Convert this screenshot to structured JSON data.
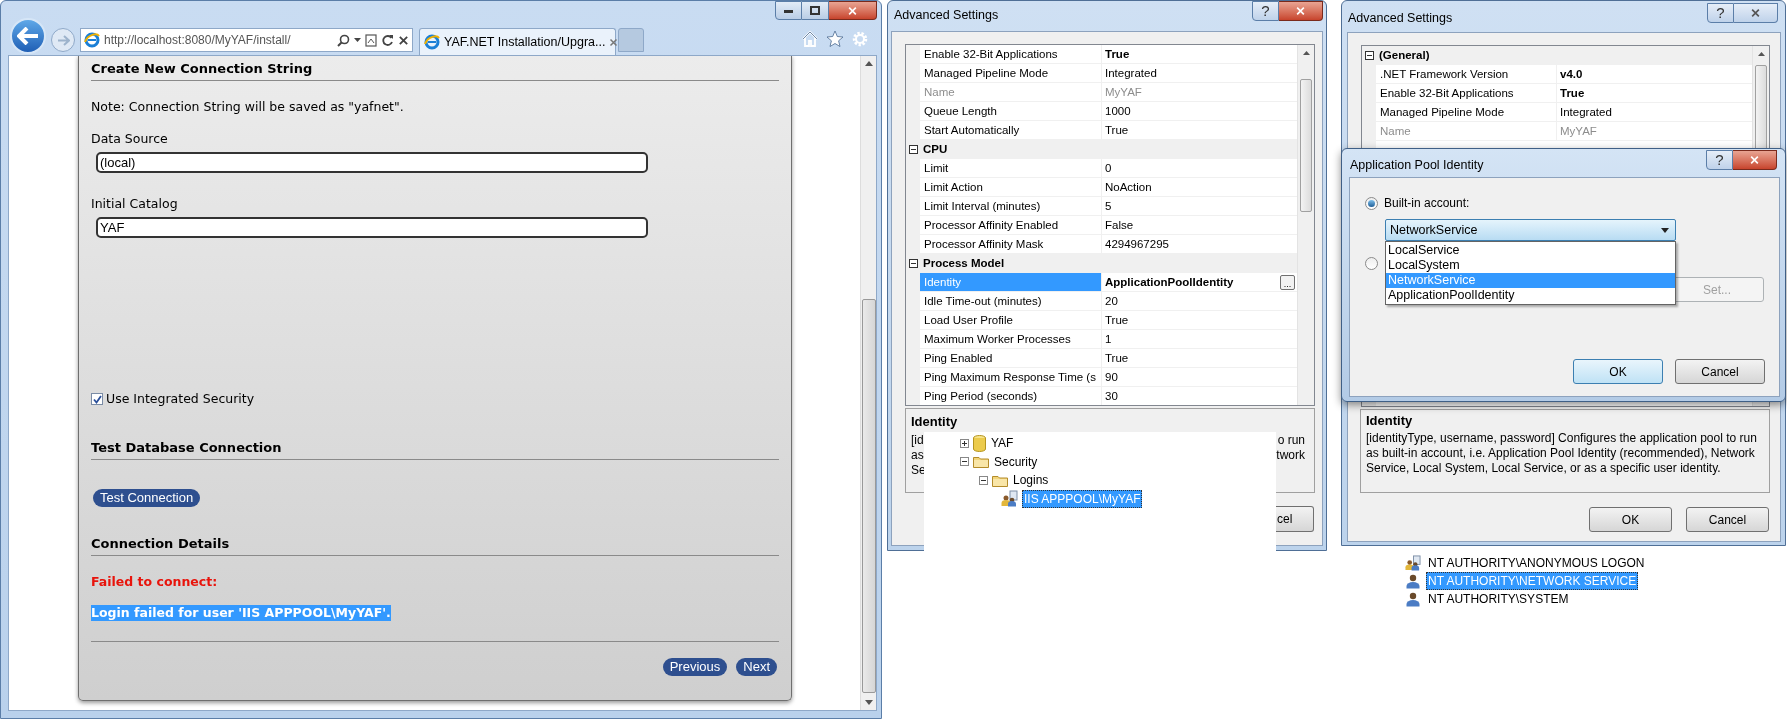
{
  "browser": {
    "address": "http://localhost:8080/MyYAF/install/",
    "tab_title": "YAF.NET Installation/Upgra..."
  },
  "page": {
    "heading_1": "Create New Connection String",
    "note": "Note: Connection String will be saved as \"yafnet\".",
    "fields": [
      {
        "label": "Data Source",
        "value": "(local)"
      },
      {
        "label": "Initial Catalog",
        "value": "YAF"
      }
    ],
    "integrated_security": {
      "label": "Use Integrated Security",
      "checked": true
    },
    "heading_2": "Test Database Connection",
    "test_button": "Test Connection",
    "heading_3": "Connection Details",
    "error_title": "Failed to connect:",
    "error_message": {
      "text": "Login failed for user 'IIS APPPOOL\\MyYAF'.",
      "selected": true
    },
    "nav_buttons": [
      "Previous",
      "Next"
    ]
  },
  "settings_window_left": {
    "title": "Advanced Settings",
    "help_button": "?",
    "rows": [
      {
        "kind": "property",
        "name": "Enable 32-Bit Applications",
        "value": "True",
        "modified": true,
        "disabled": false,
        "selected": false
      },
      {
        "kind": "property",
        "name": "Managed Pipeline Mode",
        "value": "Integrated",
        "modified": false,
        "disabled": false,
        "selected": false
      },
      {
        "kind": "property",
        "name": "Name",
        "value": "MyYAF",
        "modified": false,
        "disabled": true,
        "selected": false
      },
      {
        "kind": "property",
        "name": "Queue Length",
        "value": "1000",
        "modified": false,
        "disabled": false,
        "selected": false
      },
      {
        "kind": "property",
        "name": "Start Automatically",
        "value": "True",
        "modified": false,
        "disabled": false,
        "selected": false
      },
      {
        "kind": "category",
        "name": "CPU",
        "expanded": true,
        "selected": false
      },
      {
        "kind": "property",
        "name": "Limit",
        "value": "0",
        "modified": false,
        "disabled": false,
        "selected": false
      },
      {
        "kind": "property",
        "name": "Limit Action",
        "value": "NoAction",
        "modified": false,
        "disabled": false,
        "selected": false
      },
      {
        "kind": "property",
        "name": "Limit Interval (minutes)",
        "value": "5",
        "modified": false,
        "disabled": false,
        "selected": false
      },
      {
        "kind": "property",
        "name": "Processor Affinity Enabled",
        "value": "False",
        "modified": false,
        "disabled": false,
        "selected": false
      },
      {
        "kind": "property",
        "name": "Processor Affinity Mask",
        "value": "4294967295",
        "modified": false,
        "disabled": false,
        "selected": false
      },
      {
        "kind": "category",
        "name": "Process Model",
        "expanded": true,
        "selected": false
      },
      {
        "kind": "property",
        "name": "Identity",
        "value": "ApplicationPoolIdentity",
        "modified": true,
        "disabled": false,
        "selected": true,
        "button": "..."
      },
      {
        "kind": "property",
        "name": "Idle Time-out (minutes)",
        "value": "20",
        "modified": false,
        "disabled": false,
        "selected": false
      },
      {
        "kind": "property",
        "name": "Load User Profile",
        "value": "True",
        "modified": false,
        "disabled": false,
        "selected": false
      },
      {
        "kind": "property",
        "name": "Maximum Worker Processes",
        "value": "1",
        "modified": false,
        "disabled": false,
        "selected": false
      },
      {
        "kind": "property",
        "name": "Ping Enabled",
        "value": "True",
        "modified": false,
        "disabled": false,
        "selected": false
      },
      {
        "kind": "property",
        "name": "Ping Maximum Response Time (s",
        "value": "90",
        "modified": false,
        "disabled": false,
        "selected": false
      },
      {
        "kind": "property",
        "name": "Ping Period (seconds)",
        "value": "30",
        "modified": false,
        "disabled": false,
        "selected": false
      }
    ],
    "description": {
      "title": "Identity",
      "left_fragments": [
        "[id",
        "as",
        "Se"
      ],
      "right_fragments": [
        "o run",
        "twork"
      ]
    },
    "cancel_fragment": "cel"
  },
  "login_tree": [
    {
      "label": "YAF",
      "kind": "database",
      "expanded": false,
      "selected": false
    },
    {
      "label": "Security",
      "kind": "folder",
      "expanded": true,
      "selected": false,
      "children": [
        {
          "label": "Logins",
          "kind": "folder",
          "expanded": true,
          "selected": false,
          "children": [
            {
              "label": "IIS APPPOOL\\MyYAF",
              "kind": "login",
              "selected": true
            }
          ]
        }
      ]
    }
  ],
  "settings_window_right": {
    "title": "Advanced Settings",
    "help_button": "?",
    "rows": [
      {
        "kind": "category",
        "name": "(General)",
        "expanded": true,
        "selected": false
      },
      {
        "kind": "property",
        "name": ".NET Framework Version",
        "value": "v4.0",
        "modified": true,
        "disabled": false,
        "selected": false
      },
      {
        "kind": "property",
        "name": "Enable 32-Bit Applications",
        "value": "True",
        "modified": true,
        "disabled": false,
        "selected": false
      },
      {
        "kind": "property",
        "name": "Managed Pipeline Mode",
        "value": "Integrated",
        "modified": false,
        "disabled": false,
        "selected": false
      },
      {
        "kind": "property",
        "name": "Name",
        "value": "MyYAF",
        "modified": false,
        "disabled": true,
        "selected": false
      }
    ],
    "description": {
      "title": "Identity",
      "text": "[identityType, username, password] Configures the application pool to run as built-in account, i.e. Application Pool Identity (recommended), Network Service, Local System, Local Service, or as a specific user identity."
    },
    "buttons": [
      "OK",
      "Cancel"
    ]
  },
  "identity_dialog": {
    "title": "Application Pool Identity",
    "help_button": "?",
    "options": [
      {
        "kind": "builtin",
        "label": "Built-in account:",
        "selected": true
      },
      {
        "kind": "custom",
        "selected": false
      }
    ],
    "account": "NetworkService",
    "account_options": [
      {
        "label": "LocalService",
        "selected": false
      },
      {
        "label": "LocalSystem",
        "selected": false
      },
      {
        "label": "NetworkService",
        "selected": true
      },
      {
        "label": "ApplicationPoolIdentity",
        "selected": false
      }
    ],
    "set_button": {
      "label": "Set...",
      "disabled": true
    },
    "buttons": [
      "OK",
      "Cancel"
    ]
  },
  "logins": [
    {
      "label": "NT AUTHORITY\\ANONYMOUS LOGON",
      "kind": "group",
      "selected": false
    },
    {
      "label": "NT AUTHORITY\\NETWORK SERVICE",
      "kind": "user",
      "selected": true
    },
    {
      "label": "NT AUTHORITY\\SYSTEM",
      "kind": "user",
      "selected": false
    }
  ]
}
